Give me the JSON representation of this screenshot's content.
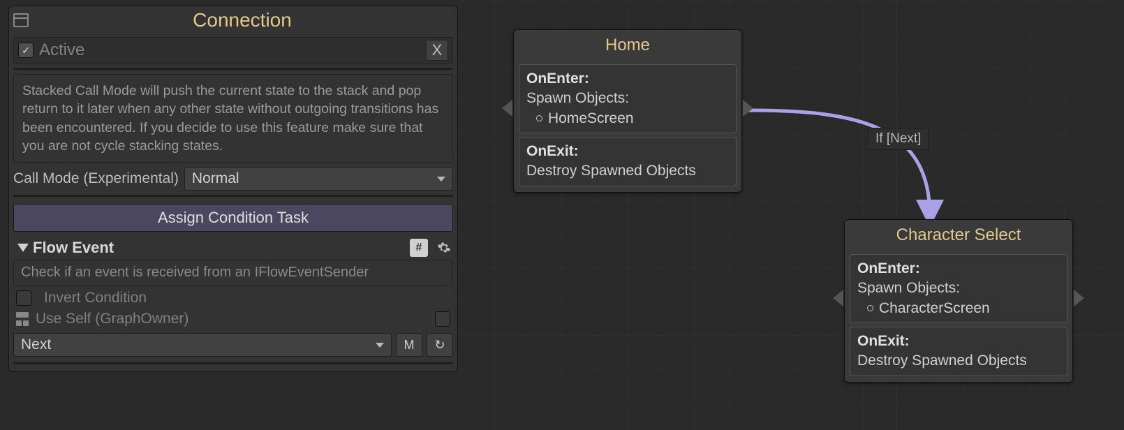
{
  "panel": {
    "title": "Connection",
    "active": {
      "label": "Active",
      "checked": true,
      "close_label": "X"
    },
    "info": "Stacked Call Mode will push the current state to the stack and pop return to it later when any other state without outgoing transitions has been encountered. If you decide to use this feature make sure that you are not cycle stacking states.",
    "call_mode": {
      "label": "Call Mode (Experimental)",
      "value": "Normal"
    },
    "assign_btn": "Assign Condition Task",
    "flow_event": {
      "title": "Flow Event",
      "hash": "#",
      "desc": "Check if an event is received from an IFlowEventSender",
      "invert_label": "Invert Condition",
      "use_self_label": "Use Self (GraphOwner)",
      "value": "Next",
      "btn_m": "M",
      "btn_reload": "↻"
    }
  },
  "edge": {
    "label": "If [Next]"
  },
  "nodes": {
    "home": {
      "title": "Home",
      "enter_label": "OnEnter:",
      "spawn_label": "Spawn Objects:",
      "spawn_item": "HomeScreen",
      "exit_label": "OnExit:",
      "exit_action": "Destroy Spawned Objects"
    },
    "char": {
      "title": "Character Select",
      "enter_label": "OnEnter:",
      "spawn_label": "Spawn Objects:",
      "spawn_item": "CharacterScreen",
      "exit_label": "OnExit:",
      "exit_action": "Destroy Spawned Objects"
    }
  }
}
